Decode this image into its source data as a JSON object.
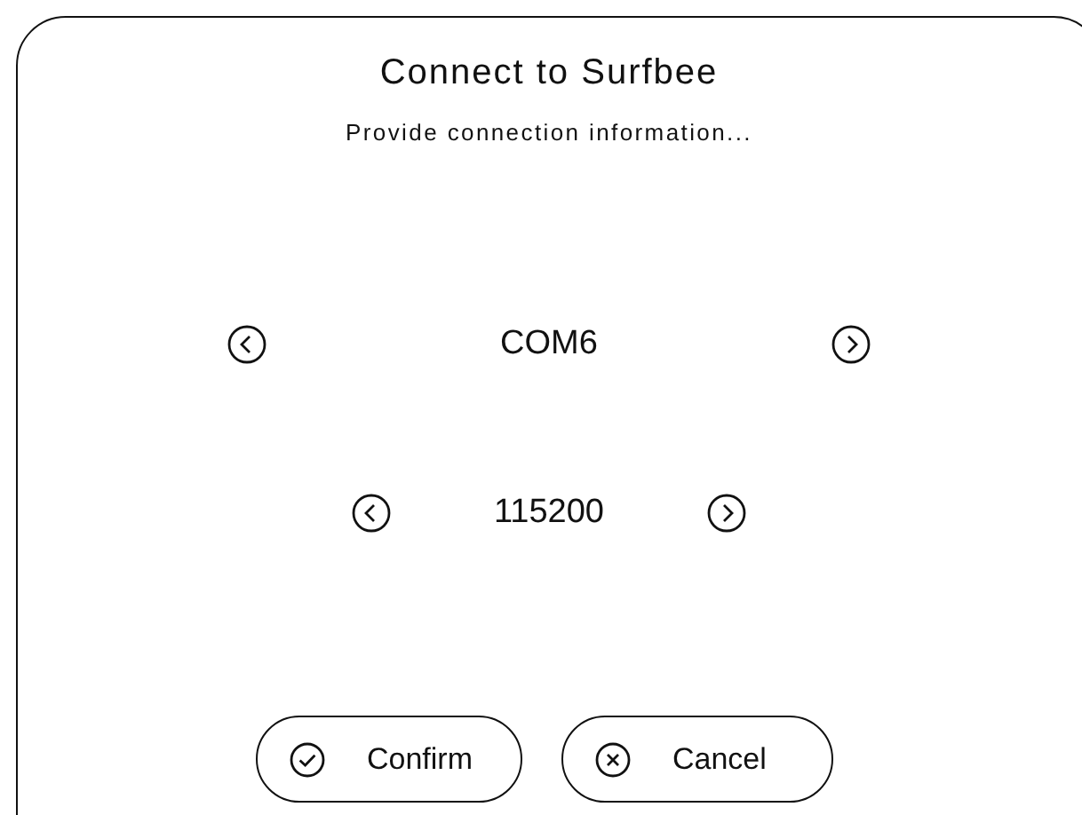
{
  "dialog": {
    "title": "Connect to Surfbee",
    "subtitle": "Provide connection information..."
  },
  "selectors": [
    {
      "value": "COM6"
    },
    {
      "value": "115200"
    }
  ],
  "buttons": [
    {
      "kind": "confirm",
      "label": "Confirm"
    },
    {
      "kind": "cancel",
      "label": "Cancel"
    }
  ]
}
